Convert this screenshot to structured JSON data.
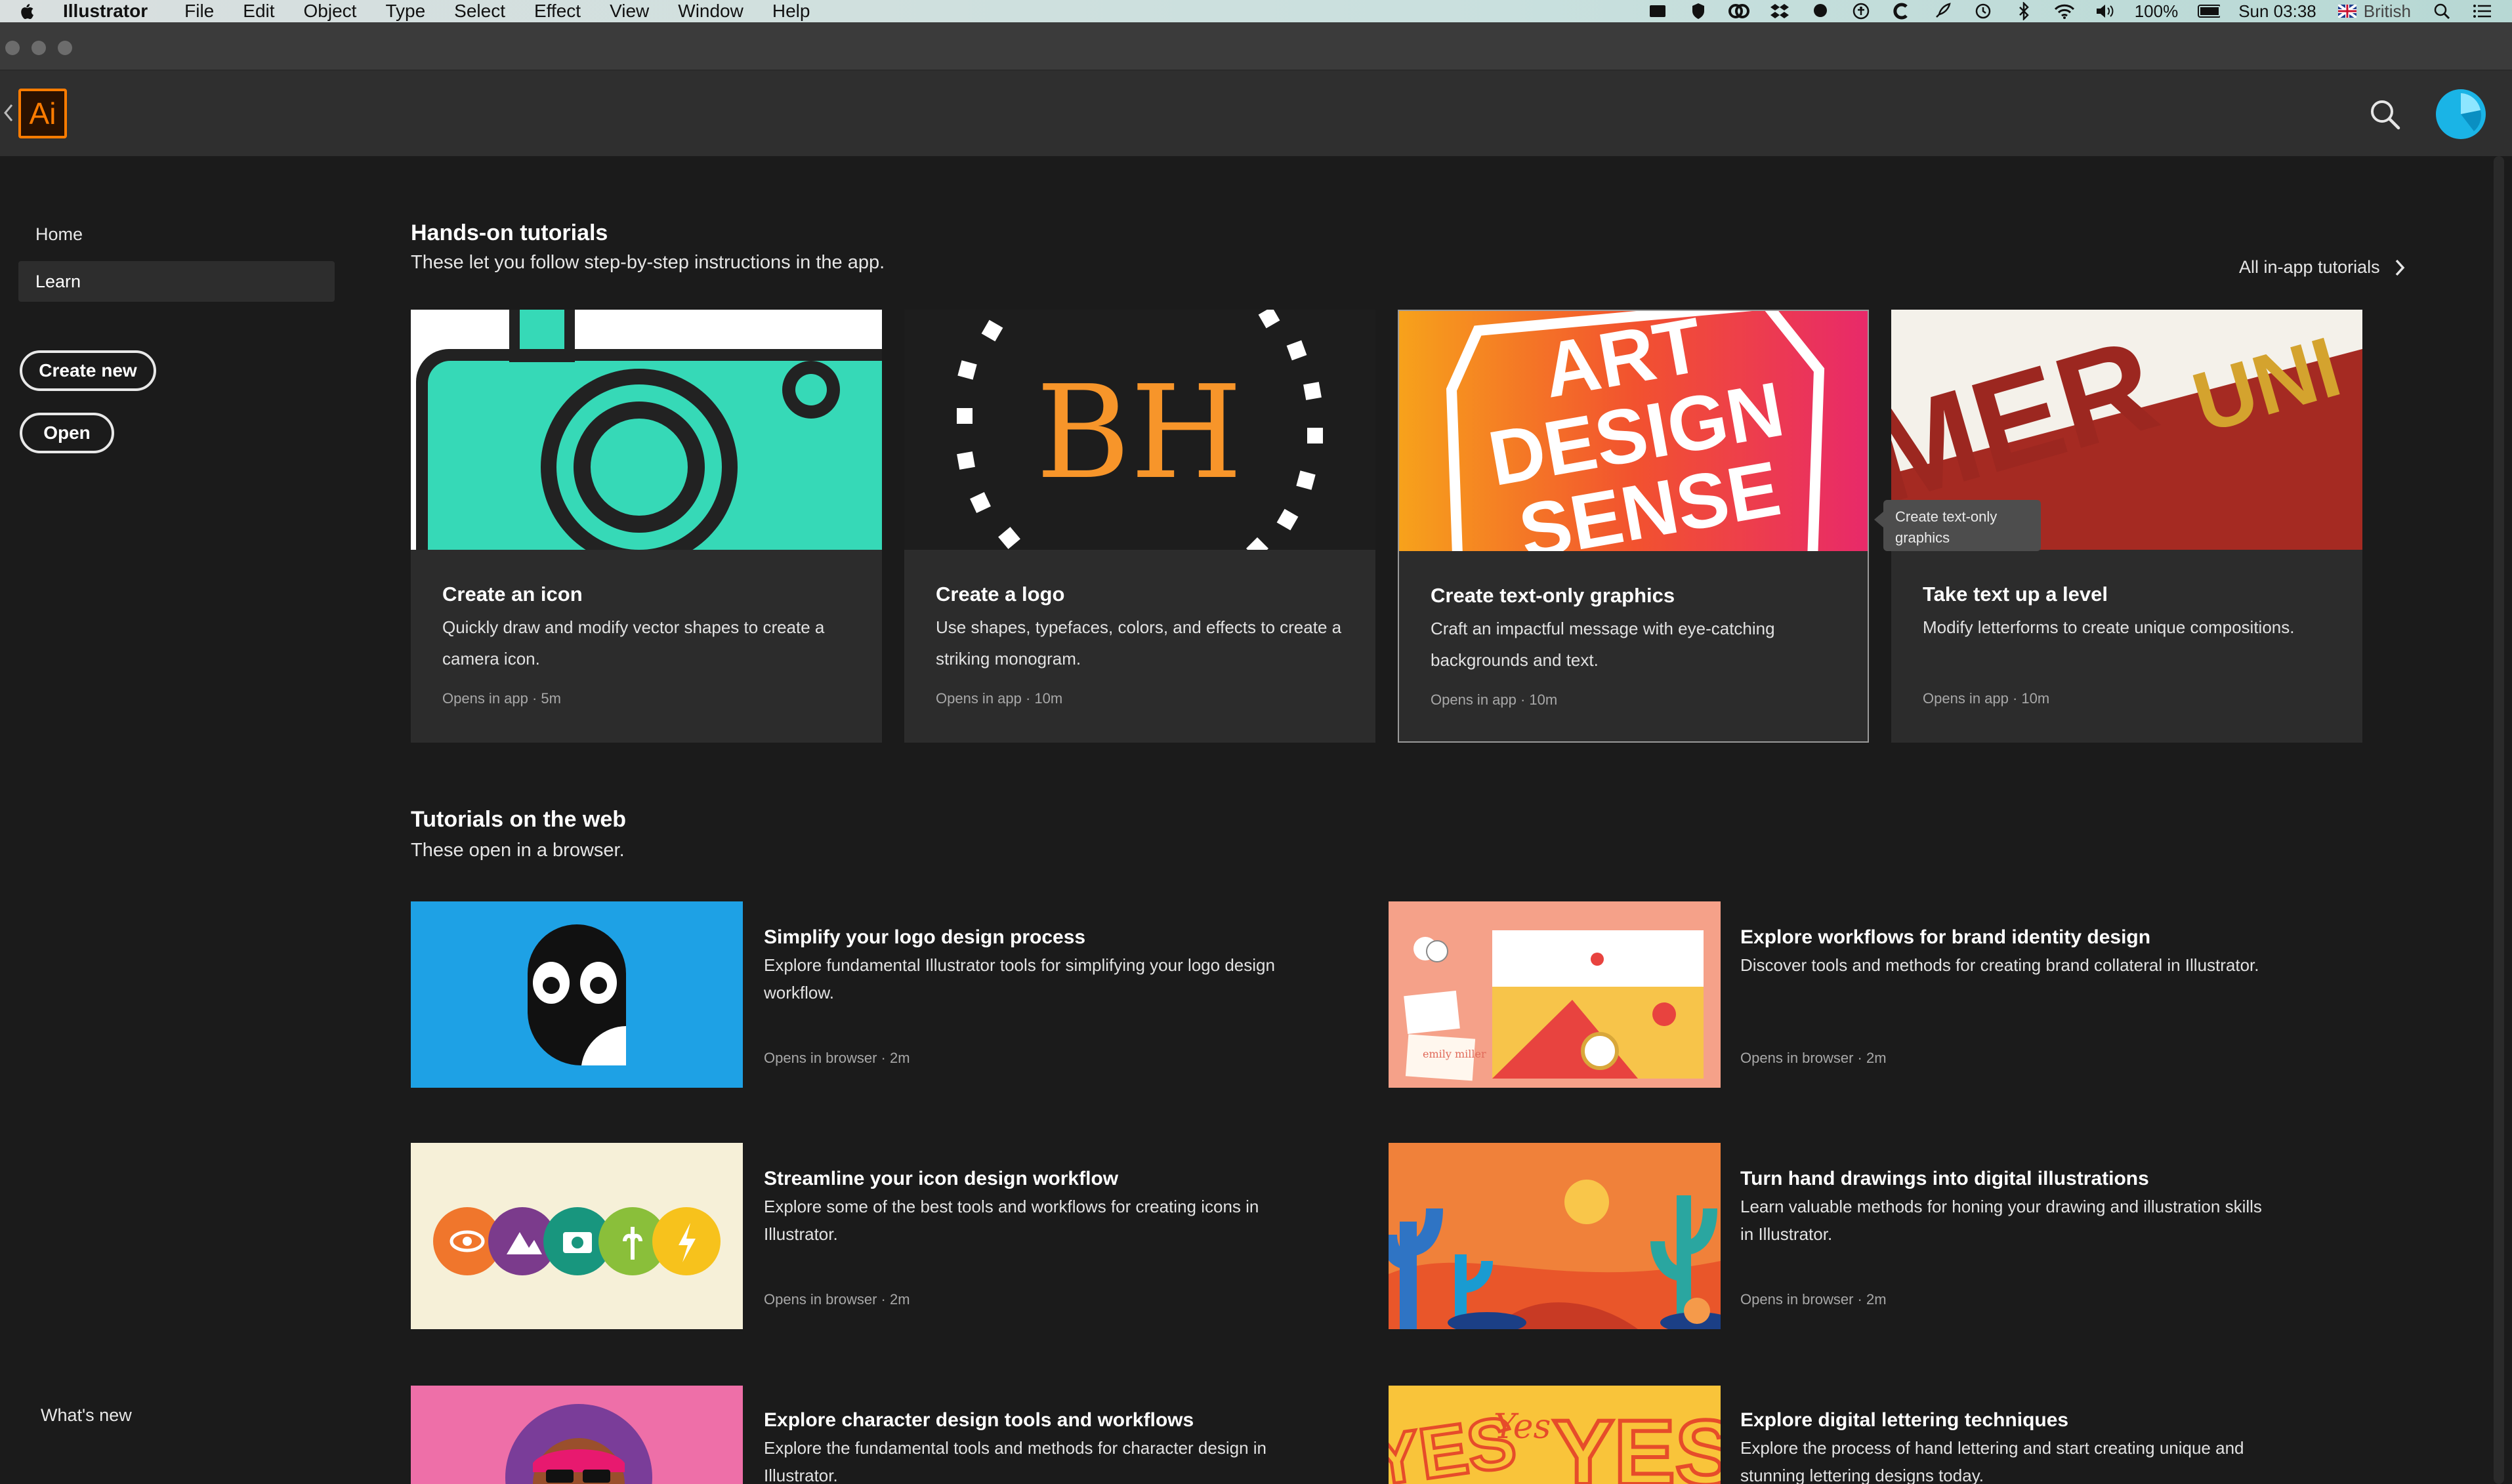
{
  "menubar": {
    "app_name": "Illustrator",
    "menus": [
      "File",
      "Edit",
      "Object",
      "Type",
      "Select",
      "Effect",
      "View",
      "Window",
      "Help"
    ],
    "battery": "100%",
    "clock": "Sun 03:38",
    "input_source": "British"
  },
  "app": {
    "logo_text": "Ai"
  },
  "sidebar": {
    "home": "Home",
    "learn": "Learn",
    "create_new": "Create new",
    "open": "Open",
    "whats_new": "What's new"
  },
  "hands_on": {
    "title": "Hands-on tutorials",
    "subtitle": "These let you follow step-by-step instructions in the app.",
    "all_link": "All in-app tutorials",
    "tooltip": "Create text-only graphics",
    "cards": [
      {
        "title": "Create an icon",
        "desc": "Quickly draw and modify vector shapes to create a camera icon.",
        "meta": "Opens in app  ·  5m"
      },
      {
        "title": "Create a logo",
        "desc": "Use shapes, typefaces, colors, and effects to create a striking monogram.",
        "meta": "Opens in app  ·  10m",
        "thumb_text": "BH"
      },
      {
        "title": "Create text-only graphics",
        "desc": "Craft an impactful message with eye-catching backgrounds and text.",
        "meta": "Opens in app  ·  10m",
        "thumb_lines": [
          "ART",
          "DESIGN",
          "SENSE"
        ]
      },
      {
        "title": "Take text up a level",
        "desc": "Modify letterforms to create unique compositions.",
        "meta": "Opens in app  ·  10m",
        "thumb_text": "MER"
      }
    ]
  },
  "web": {
    "title": "Tutorials on the web",
    "subtitle": "These open in a browser.",
    "items": [
      {
        "title": "Simplify your logo design process",
        "desc": "Explore fundamental Illustrator tools for simplifying your logo design workflow.",
        "meta": "Opens in browser  ·  2m"
      },
      {
        "title": "Explore workflows for brand identity design",
        "desc": "Discover tools and methods for creating brand collateral in Illustrator.",
        "meta": "Opens in browser  ·  2m",
        "thumb_text": "emily miller"
      },
      {
        "title": "Streamline your icon design workflow",
        "desc": "Explore some of the best tools and workflows for creating icons in Illustrator.",
        "meta": "Opens in browser  ·  2m"
      },
      {
        "title": "Turn hand drawings into digital illustrations",
        "desc": "Learn valuable methods for honing your drawing and illustration skills in Illustrator.",
        "meta": "Opens in browser  ·  2m"
      },
      {
        "title": "Explore character design tools and workflows",
        "desc": "Explore the fundamental tools and methods for character design in Illustrator.",
        "meta": ""
      },
      {
        "title": "Explore digital lettering techniques",
        "desc": "Explore the process of hand lettering and start creating unique and stunning lettering designs today.",
        "meta": "",
        "thumb_text": "YES"
      }
    ]
  }
}
